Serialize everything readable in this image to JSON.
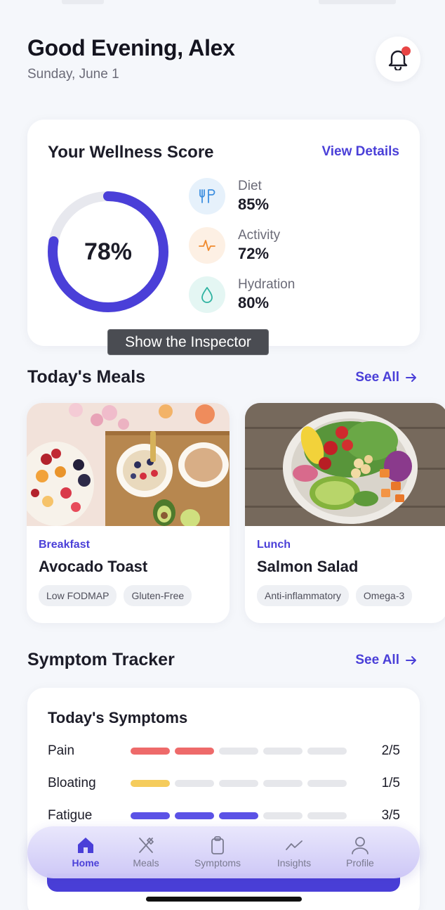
{
  "header": {
    "greeting": "Good Evening, Alex",
    "date": "Sunday, June 1"
  },
  "wellness": {
    "title": "Your Wellness Score",
    "view_details": "View Details",
    "score": 78,
    "score_label": "78%",
    "accent_color": "#4a3fd8",
    "metrics": [
      {
        "icon": "fork-knife-icon",
        "label": "Diet",
        "value": "85%"
      },
      {
        "icon": "pulse-icon",
        "label": "Activity",
        "value": "72%"
      },
      {
        "icon": "water-drop-icon",
        "label": "Hydration",
        "value": "80%"
      }
    ]
  },
  "tooltip": "Show the Inspector",
  "meals": {
    "title": "Today's Meals",
    "see_all": "See All",
    "items": [
      {
        "type": "Breakfast",
        "name": "Avocado Toast",
        "tags": [
          "Low FODMAP",
          "Gluten-Free"
        ]
      },
      {
        "type": "Lunch",
        "name": "Salmon Salad",
        "tags": [
          "Anti-inflammatory",
          "Omega-3"
        ]
      }
    ]
  },
  "symptoms": {
    "section_title": "Symptom Tracker",
    "see_all": "See All",
    "card_title": "Today's Symptoms",
    "items": [
      {
        "label": "Pain",
        "score": 2,
        "max": 5,
        "value": "2/5",
        "color": "#ee6a6a"
      },
      {
        "label": "Bloating",
        "score": 1,
        "max": 5,
        "value": "1/5",
        "color": "#f5cc5c"
      },
      {
        "label": "Fatigue",
        "score": 3,
        "max": 5,
        "value": "3/5",
        "color": "#5b52e6"
      }
    ]
  },
  "tabbar": {
    "items": [
      {
        "label": "Home",
        "icon": "home-icon",
        "active": true
      },
      {
        "label": "Meals",
        "icon": "utensils-icon",
        "active": false
      },
      {
        "label": "Symptoms",
        "icon": "clipboard-icon",
        "active": false
      },
      {
        "label": "Insights",
        "icon": "trend-line-icon",
        "active": false
      },
      {
        "label": "Profile",
        "icon": "person-icon",
        "active": false
      }
    ]
  }
}
